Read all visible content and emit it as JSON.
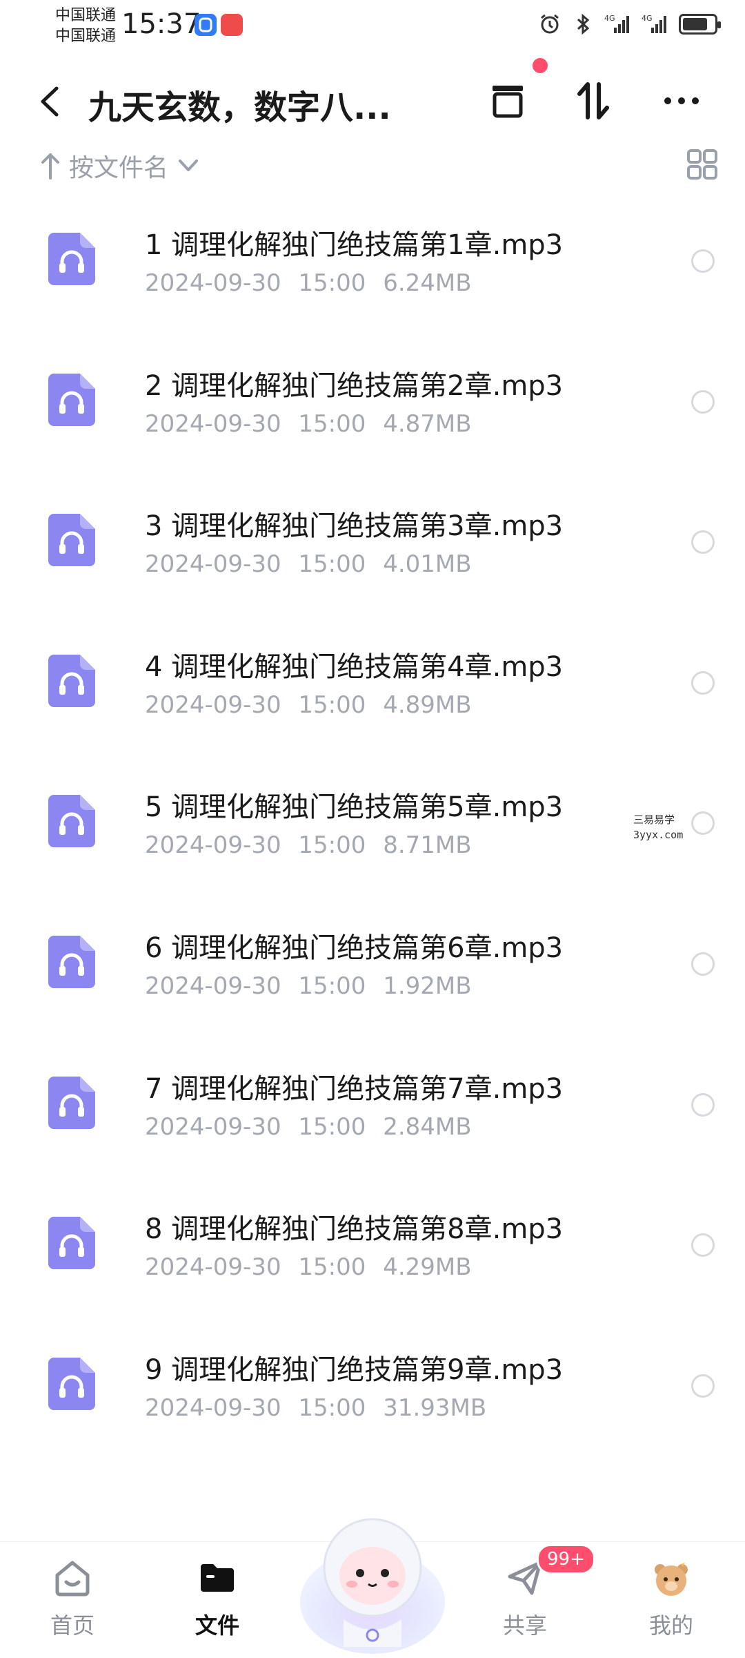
{
  "status_bar": {
    "carrier_1": "中国联通",
    "carrier_2": "中国联通",
    "time": "15:37",
    "network_1": "4G",
    "network_2": "4G",
    "battery_level": 0.8
  },
  "header": {
    "title": "九天玄数，数字八...",
    "back_icon": "chevron-left-icon",
    "actions": [
      "archive-icon",
      "transfer-icon",
      "more-icon"
    ]
  },
  "sort": {
    "label": "按文件名",
    "direction": "ascending"
  },
  "files": [
    {
      "name": "1 调理化解独门绝技篇第1章.mp3",
      "date": "2024-09-30",
      "time": "15:00",
      "size": "6.24MB"
    },
    {
      "name": "2 调理化解独门绝技篇第2章.mp3",
      "date": "2024-09-30",
      "time": "15:00",
      "size": "4.87MB"
    },
    {
      "name": "3 调理化解独门绝技篇第3章.mp3",
      "date": "2024-09-30",
      "time": "15:00",
      "size": "4.01MB"
    },
    {
      "name": "4 调理化解独门绝技篇第4章.mp3",
      "date": "2024-09-30",
      "time": "15:00",
      "size": "4.89MB"
    },
    {
      "name": "5 调理化解独门绝技篇第5章.mp3",
      "date": "2024-09-30",
      "time": "15:00",
      "size": "8.71MB"
    },
    {
      "name": "6 调理化解独门绝技篇第6章.mp3",
      "date": "2024-09-30",
      "time": "15:00",
      "size": "1.92MB"
    },
    {
      "name": "7 调理化解独门绝技篇第7章.mp3",
      "date": "2024-09-30",
      "time": "15:00",
      "size": "2.84MB"
    },
    {
      "name": "8 调理化解独门绝技篇第8章.mp3",
      "date": "2024-09-30",
      "time": "15:00",
      "size": "4.29MB"
    },
    {
      "name": "9 调理化解独门绝技篇第9章.mp3",
      "date": "2024-09-30",
      "time": "15:00",
      "size": "31.93MB"
    }
  ],
  "watermark": {
    "line1": "三易易学",
    "line2": "3yyx.com"
  },
  "bottom_nav": {
    "home": "首页",
    "files": "文件",
    "share": "共享",
    "mine": "我的",
    "share_badge": "99+"
  },
  "colors": {
    "accent_purple": "#8b86f0",
    "badge_red": "#ff4d6d",
    "meta_gray": "#a4a8b0"
  }
}
